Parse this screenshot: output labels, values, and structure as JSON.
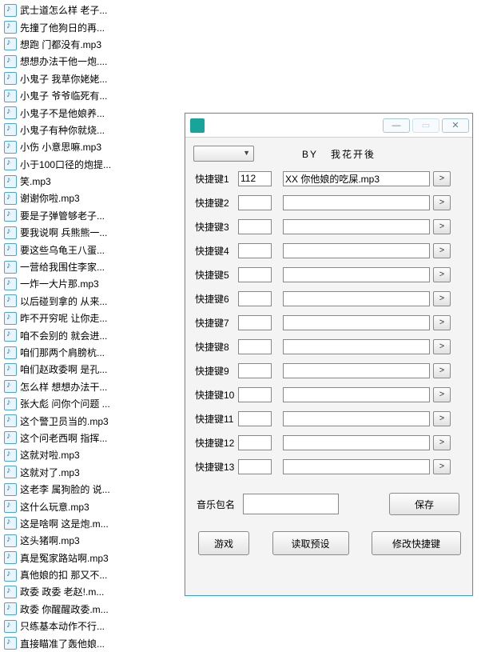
{
  "files": [
    "武士道怎么样 老子...",
    "先撞了他狗日的再...",
    "想跑 门都没有.mp3",
    "想想办法干他一炮....",
    "小鬼子 我草你姥姥...",
    "小鬼子 爷爷临死有...",
    "小鬼子不是他娘养...",
    "小鬼子有种你就烧...",
    "小伤 小意思嘛.mp3",
    "小于100口径的炮提...",
    "笑.mp3",
    "谢谢你啦.mp3",
    "要是子弹管够老子...",
    "要我说啊 兵熊熊一...",
    "要这些乌龟王八蛋...",
    "一营给我围住李家...",
    "一炸一大片那.mp3",
    "以后碰到拿的 从来...",
    "昨不开穷呢 让你走...",
    "咱不会别的 就会进...",
    "咱们那两个肩膀杭...",
    "咱们赵政委啊 是孔...",
    "怎么样 想想办法干...",
    "张大彪 问你个问题 ...",
    "这个警卫员当的.mp3",
    "这个问老西啊 指挥...",
    "这就对啦.mp3",
    "这就对了.mp3",
    "这老李 属狗脸的 说...",
    "这什么玩意.mp3",
    "这是啥啊 这是炮.m...",
    "这头猪啊.mp3",
    "真是冤家路站啊.mp3",
    "真他娘的扣 那又不...",
    "政委   政委 老赵!.m...",
    "政委 你醒醒政委.m...",
    "只练基本动作不行...",
    "直接瞄准了轰他娘..."
  ],
  "dialog": {
    "by": "BY",
    "author": "我花开後",
    "hotkey_label_prefix": "快捷键",
    "rows": [
      {
        "key": "112",
        "path": "XX 你他娘的吃屎.mp3"
      },
      {
        "key": "",
        "path": ""
      },
      {
        "key": "",
        "path": ""
      },
      {
        "key": "",
        "path": ""
      },
      {
        "key": "",
        "path": ""
      },
      {
        "key": "",
        "path": ""
      },
      {
        "key": "",
        "path": ""
      },
      {
        "key": "",
        "path": ""
      },
      {
        "key": "",
        "path": ""
      },
      {
        "key": "",
        "path": ""
      },
      {
        "key": "",
        "path": ""
      },
      {
        "key": "",
        "path": ""
      },
      {
        "key": "",
        "path": ""
      }
    ],
    "browse_glyph": ">",
    "pack_name_label": "音乐包名",
    "save_label": "保存",
    "game_label": "游戏",
    "load_preset_label": "读取预设",
    "modify_hotkey_label": "修改快捷键"
  }
}
